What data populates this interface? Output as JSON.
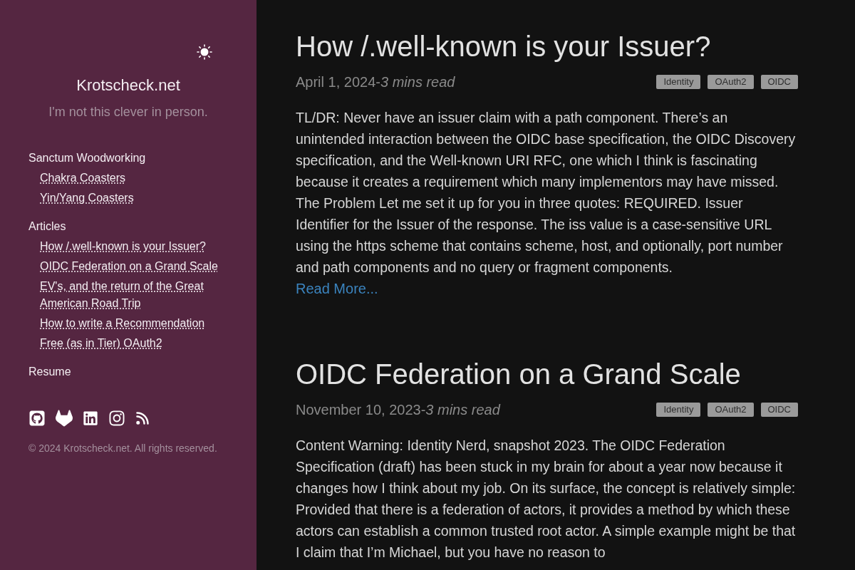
{
  "sidebar": {
    "site_title": "Krotscheck.net",
    "tagline": "I'm not this clever in person.",
    "nav": [
      {
        "label": "Sanctum Woodworking",
        "children": [
          {
            "label": "Chakra Coasters"
          },
          {
            "label": "Yin/Yang Coasters"
          }
        ]
      },
      {
        "label": "Articles",
        "children": [
          {
            "label": "How /.well-known is your Issuer?"
          },
          {
            "label": "OIDC Federation on a Grand Scale"
          },
          {
            "label": "EV's, and the return of the Great American Road Trip"
          },
          {
            "label": "How to write a Recommendation"
          },
          {
            "label": "Free (as in Tier) OAuth2"
          }
        ]
      },
      {
        "label": "Resume"
      }
    ],
    "copyright": "© 2024 Krotscheck.net. All rights reserved."
  },
  "articles": [
    {
      "title": "How /.well-known is your Issuer?",
      "byline": "April 1, 2024-*3 mins read*",
      "tags": [
        "Identity",
        "OAuth2",
        "OIDC"
      ],
      "summary": "TL/DR: Never have an issuer claim with a path component. There’s an unintended interaction between the OIDC base specification, the OIDC Discovery specification, and the Well-known URI RFC, one which I think is fascinating because it creates a requirement which many implementors may have missed. The Problem Let me set it up for you in three quotes: REQUIRED. Issuer Identifier for the Issuer of the response. The iss value is a case-sensitive URL using the https scheme that contains scheme, host, and optionally, port number and path components and no query or fragment components.",
      "read_more": "Read More..."
    },
    {
      "title": "OIDC Federation on a Grand Scale",
      "byline": "November 10, 2023-*3 mins read*",
      "tags": [
        "Identity",
        "OAuth2",
        "OIDC"
      ],
      "summary": "Content Warning: Identity Nerd, snapshot 2023. The OIDC Federation Specification (draft) has been stuck in my brain for about a year now because it changes how I think about my job. On its surface, the concept is relatively simple: Provided that there is a federation of actors, it provides a method by which these actors can establish a common trusted root actor. A simple example might be that I claim that I’m Michael, but you have no reason to"
    }
  ]
}
